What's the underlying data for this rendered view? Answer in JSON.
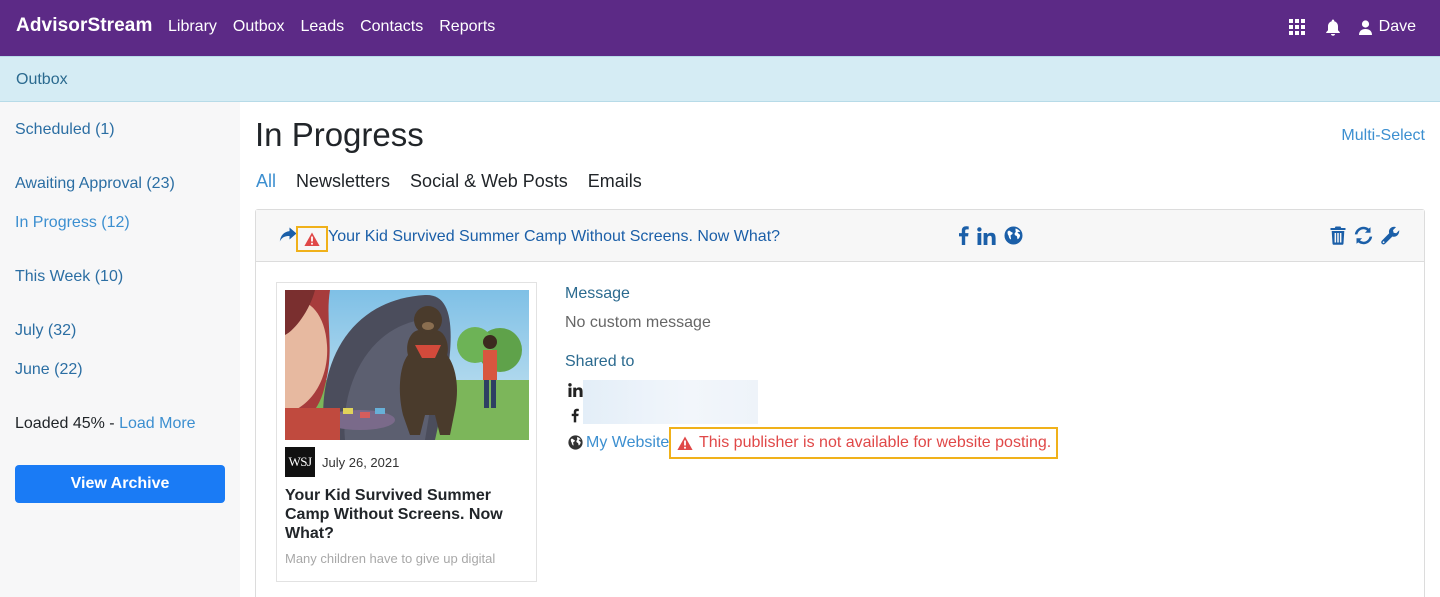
{
  "app": {
    "brand": "AdvisorStream"
  },
  "nav": {
    "links": [
      "Library",
      "Outbox",
      "Leads",
      "Contacts",
      "Reports"
    ],
    "icons": [
      "grid-icon",
      "bell-icon",
      "user-icon"
    ],
    "user_name": "Dave"
  },
  "breadcrumb": {
    "label": "Outbox"
  },
  "sidebar": {
    "scheduled": "Scheduled (1)",
    "awaiting": "Awaiting Approval (23)",
    "in_progress": "In Progress (12)",
    "this_week": "This Week (10)",
    "july": "July (32)",
    "june": "June (22)",
    "loaded_text": "Loaded 45% - ",
    "load_more": "Load More",
    "view_archive": "View Archive"
  },
  "main": {
    "title": "In Progress",
    "multi_select": "Multi-Select",
    "tabs": [
      "All",
      "Newsletters",
      "Social & Web Posts",
      "Emails"
    ],
    "active_tab": "All"
  },
  "post": {
    "title": "Your Kid Survived Summer Camp Without Screens. Now What?",
    "channels": [
      "facebook-icon",
      "linkedin-icon",
      "globe-icon"
    ],
    "actions": [
      "trash-icon",
      "refresh-icon",
      "wrench-icon"
    ],
    "article": {
      "publisher": "WSJ",
      "date": "July 26, 2021",
      "title": "Your Kid Survived Summer Camp Without Screens. Now What?",
      "excerpt": "Many children have to give up digital"
    },
    "message_label": "Message",
    "message_value": "No custom message",
    "shared_to_label": "Shared to",
    "website_label": "My Website",
    "error_text": "This publisher is not available for website posting."
  },
  "colors": {
    "navbar": "#5c2a86",
    "link": "#3c8fd0",
    "error": "#e04848",
    "highlight": "#f0b11a",
    "primary_button": "#1a7bf5"
  }
}
